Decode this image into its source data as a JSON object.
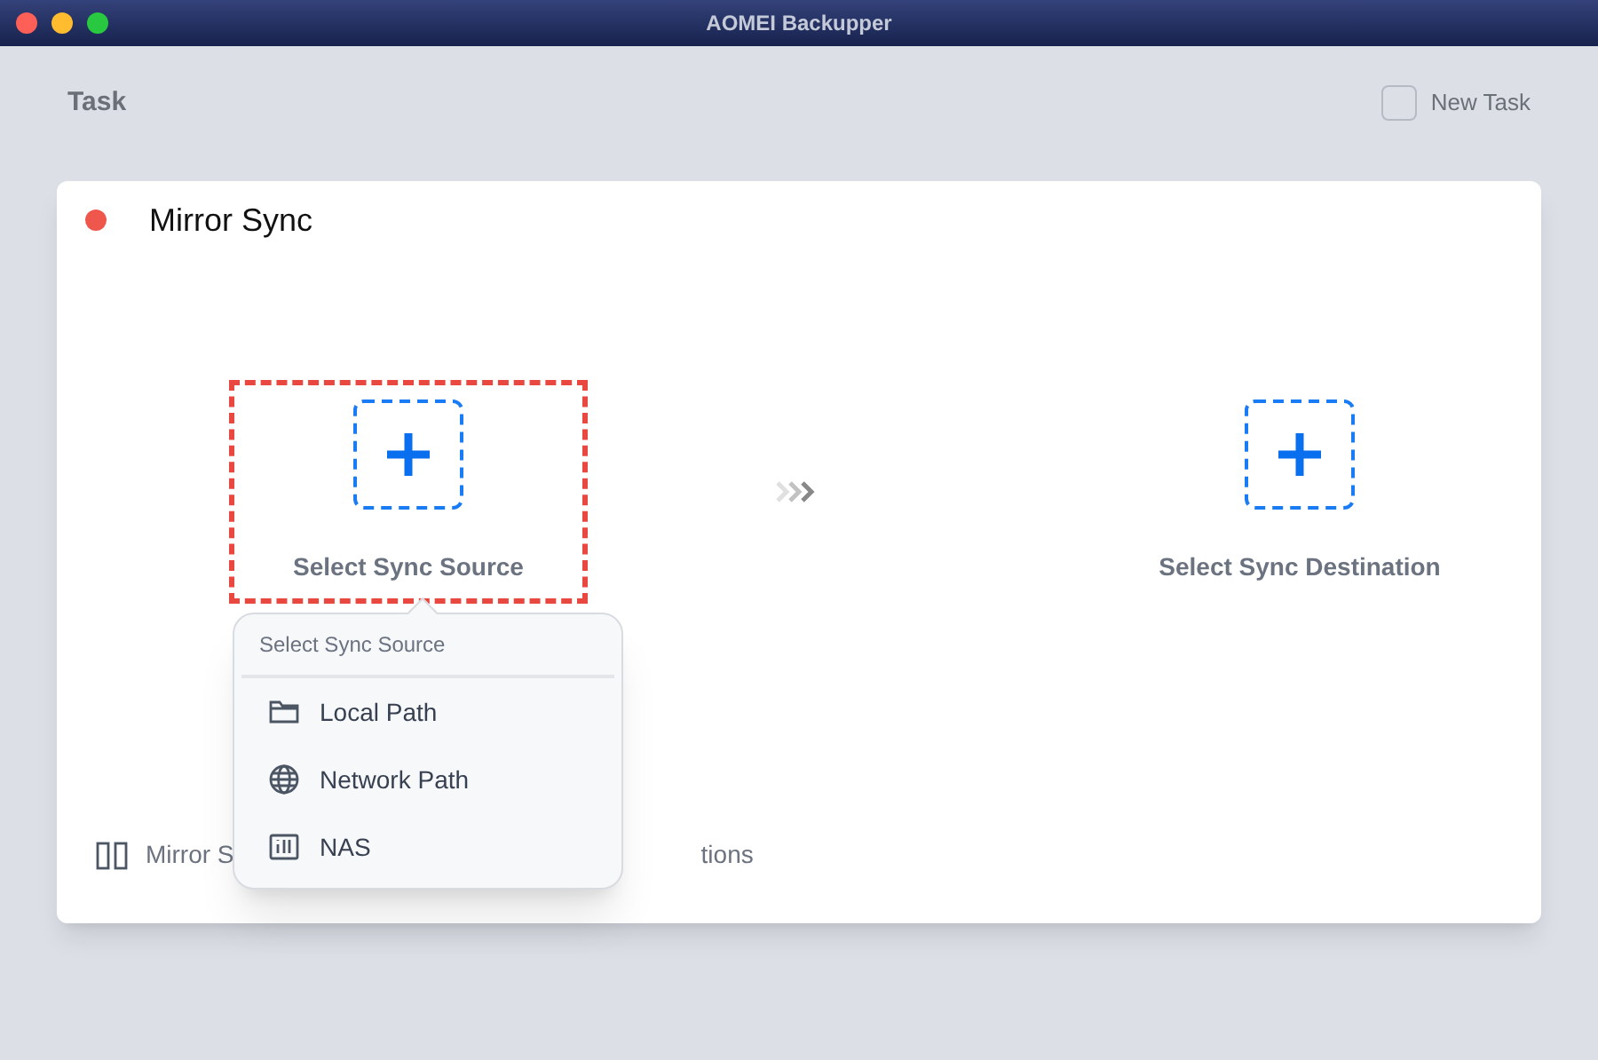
{
  "window": {
    "title": "AOMEI Backupper"
  },
  "background": {
    "heading": "Task",
    "new_task_button": "New Task"
  },
  "dialog": {
    "title": "Mirror Sync",
    "source": {
      "label": "Select Sync Source",
      "selected": true
    },
    "destination": {
      "label": "Select Sync Destination",
      "selected": false
    },
    "footer": {
      "mode_label": "Mirror S",
      "options_label": "tions"
    }
  },
  "popover": {
    "title": "Select Sync Source",
    "items": [
      {
        "kind": "folder",
        "label": "Local Path"
      },
      {
        "kind": "globe",
        "label": "Network Path"
      },
      {
        "kind": "nas",
        "label": "NAS"
      }
    ]
  }
}
